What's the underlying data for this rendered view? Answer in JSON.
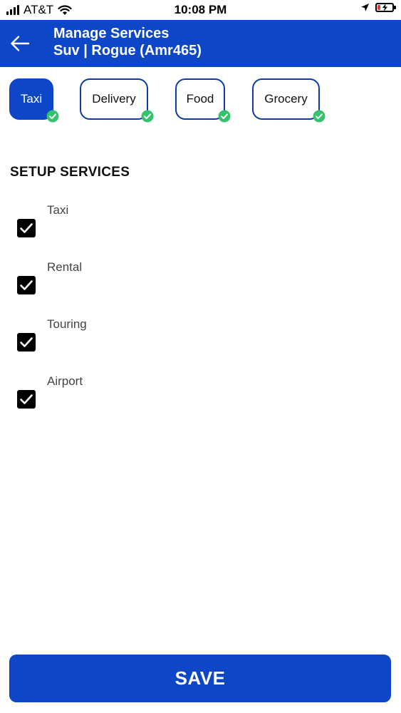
{
  "status_bar": {
    "carrier": "AT&T",
    "time": "10:08 PM",
    "icons": [
      "signal-icon",
      "wifi-icon",
      "location-arrow-icon",
      "battery-charging-icon"
    ],
    "battery_color": "#e53935"
  },
  "header": {
    "back_icon": "back-arrow-icon",
    "title": "Manage Services",
    "subtitle": "Suv | Rogue (Amr465)",
    "background": "#0d47c7"
  },
  "chips": [
    {
      "label": "Taxi",
      "active": true,
      "verified": true
    },
    {
      "label": "Delivery",
      "active": false,
      "verified": true
    },
    {
      "label": "Food",
      "active": false,
      "verified": true
    },
    {
      "label": "Grocery",
      "active": false,
      "verified": true
    }
  ],
  "section": {
    "title": "SETUP SERVICES"
  },
  "services": [
    {
      "label": "Taxi",
      "checked": true
    },
    {
      "label": "Rental",
      "checked": true
    },
    {
      "label": "Touring",
      "checked": true
    },
    {
      "label": "Airport",
      "checked": true
    }
  ],
  "save_button": {
    "label": "SAVE"
  },
  "colors": {
    "primary": "#0d47c7",
    "chip_border": "#0d3aa6",
    "verified_green": "#34c26b"
  }
}
